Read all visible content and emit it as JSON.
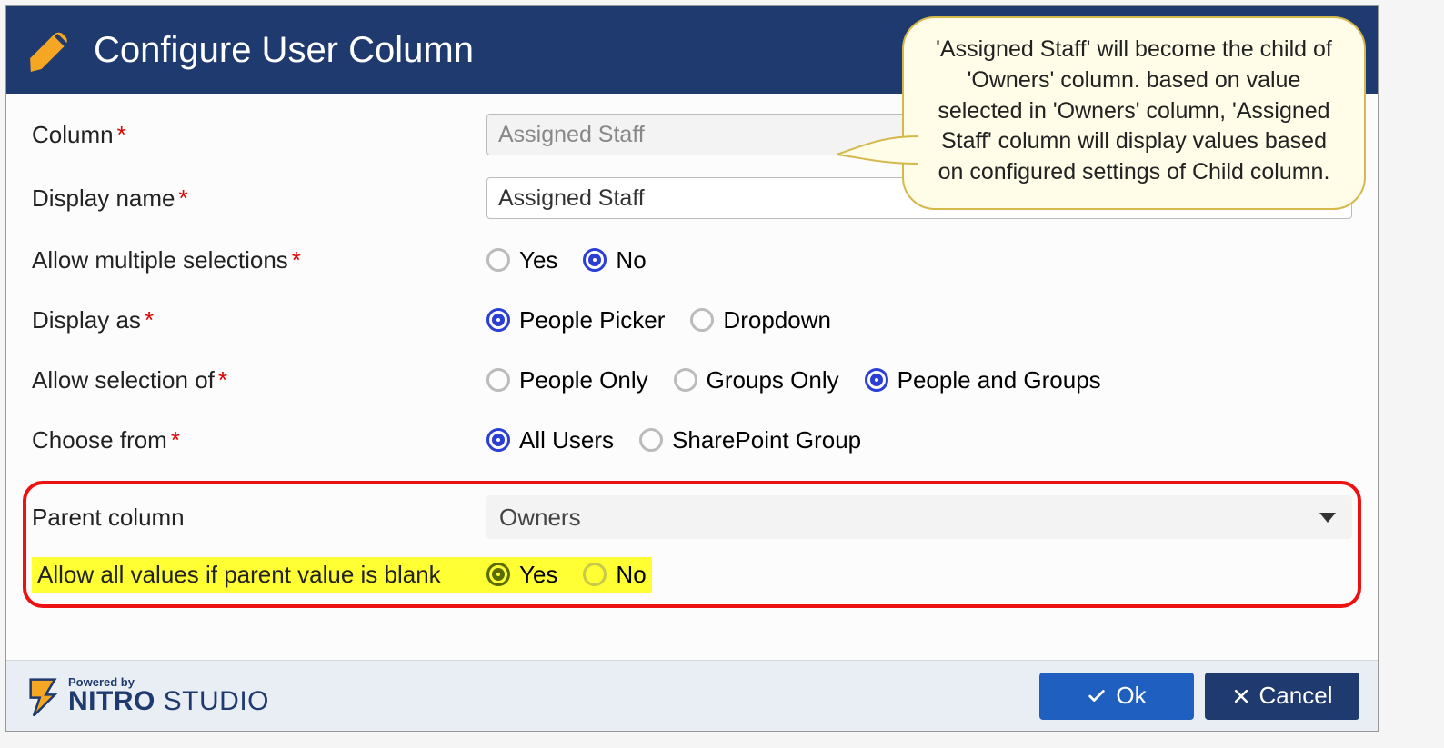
{
  "header": {
    "title": "Configure User Column"
  },
  "form": {
    "column": {
      "label": "Column",
      "value": "Assigned Staff"
    },
    "display_name": {
      "label": "Display name",
      "value": "Assigned Staff"
    },
    "allow_multiple": {
      "label": "Allow multiple selections",
      "options": {
        "yes": "Yes",
        "no": "No"
      },
      "selected": "no"
    },
    "display_as": {
      "label": "Display as",
      "options": {
        "people_picker": "People Picker",
        "dropdown": "Dropdown"
      },
      "selected": "people_picker"
    },
    "allow_selection_of": {
      "label": "Allow selection of",
      "options": {
        "people_only": "People Only",
        "groups_only": "Groups Only",
        "people_and_groups": "People and Groups"
      },
      "selected": "people_and_groups"
    },
    "choose_from": {
      "label": "Choose from",
      "options": {
        "all_users": "All Users",
        "sharepoint_group": "SharePoint Group"
      },
      "selected": "all_users"
    },
    "parent_column": {
      "label": "Parent column",
      "value": "Owners"
    },
    "allow_all_if_blank": {
      "label": "Allow all values if parent value is blank",
      "options": {
        "yes": "Yes",
        "no": "No"
      },
      "selected": "yes"
    }
  },
  "callout": {
    "text": "'Assigned Staff' will become the child of 'Owners' column. based on value selected in 'Owners' column, 'Assigned Staff' column will display values based on configured settings of Child column."
  },
  "footer": {
    "brand_powered": "Powered by",
    "brand_bold": "NITRO",
    "brand_light": "STUDIO",
    "ok": "Ok",
    "cancel": "Cancel"
  }
}
